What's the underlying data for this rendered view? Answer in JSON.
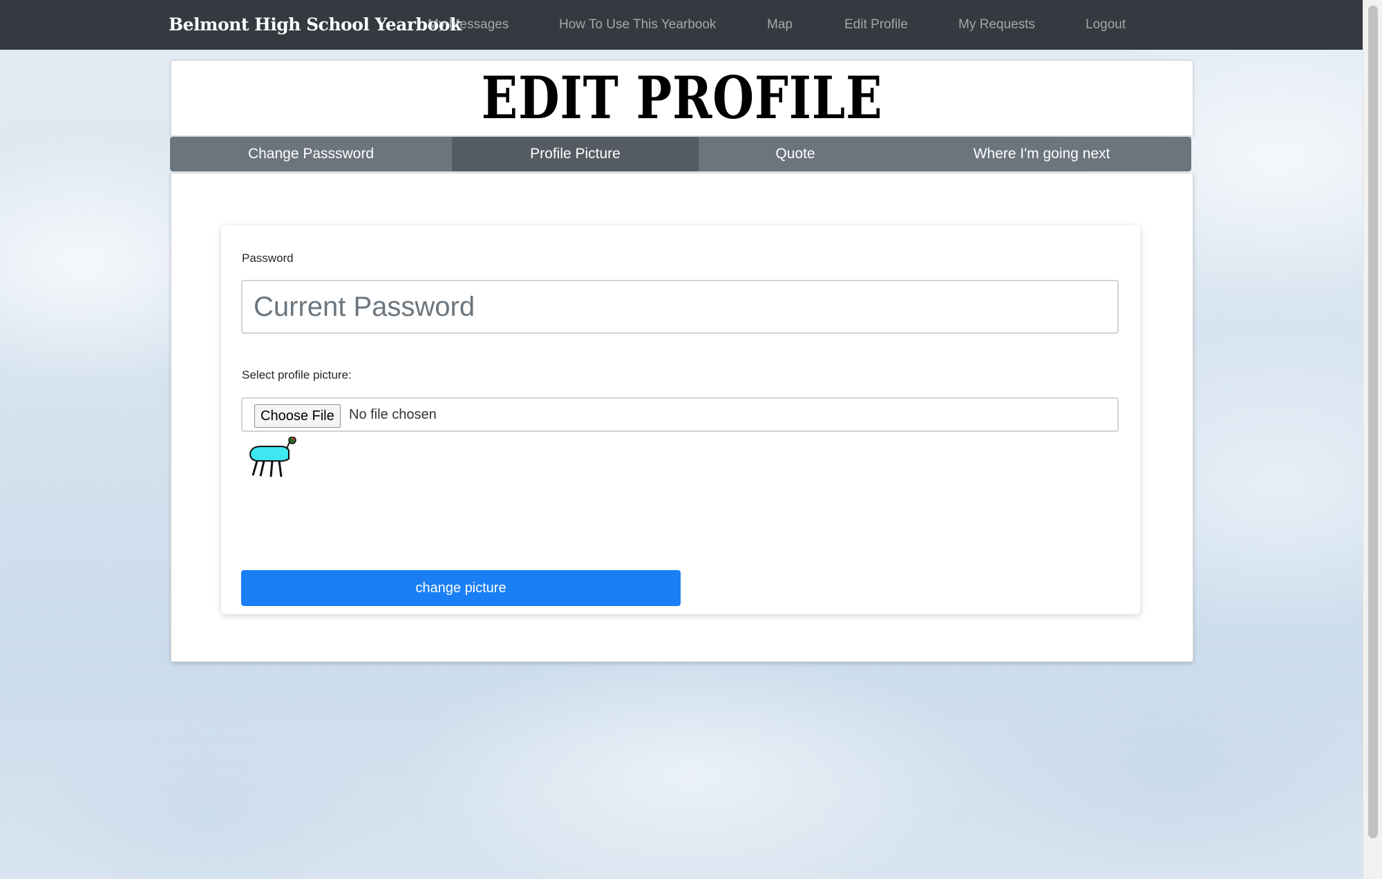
{
  "navbar": {
    "brand": "Belmont High School Yearbook",
    "links": [
      "My Messages",
      "How To Use This Yearbook",
      "Map",
      "Edit Profile",
      "My Requests",
      "Logout"
    ]
  },
  "page": {
    "title": "EDIT PROFILE"
  },
  "tabs": [
    {
      "label": "Change Passsword",
      "active": false
    },
    {
      "label": "Profile Picture",
      "active": true
    },
    {
      "label": "Quote",
      "active": false
    },
    {
      "label": "Where I'm going next",
      "active": false
    }
  ],
  "form": {
    "password_label": "Password",
    "password_placeholder": "Current Password",
    "picture_label": "Select profile picture:",
    "choose_file_label": "Choose File",
    "file_status": "No file chosen",
    "preview_icon": "stick-figure-creature-icon",
    "submit_label": "change picture"
  },
  "colors": {
    "navbar": "#343a40",
    "tab_bar": "#6c757d",
    "tab_active": "#545b62",
    "primary_button": "#1a7ff5"
  }
}
